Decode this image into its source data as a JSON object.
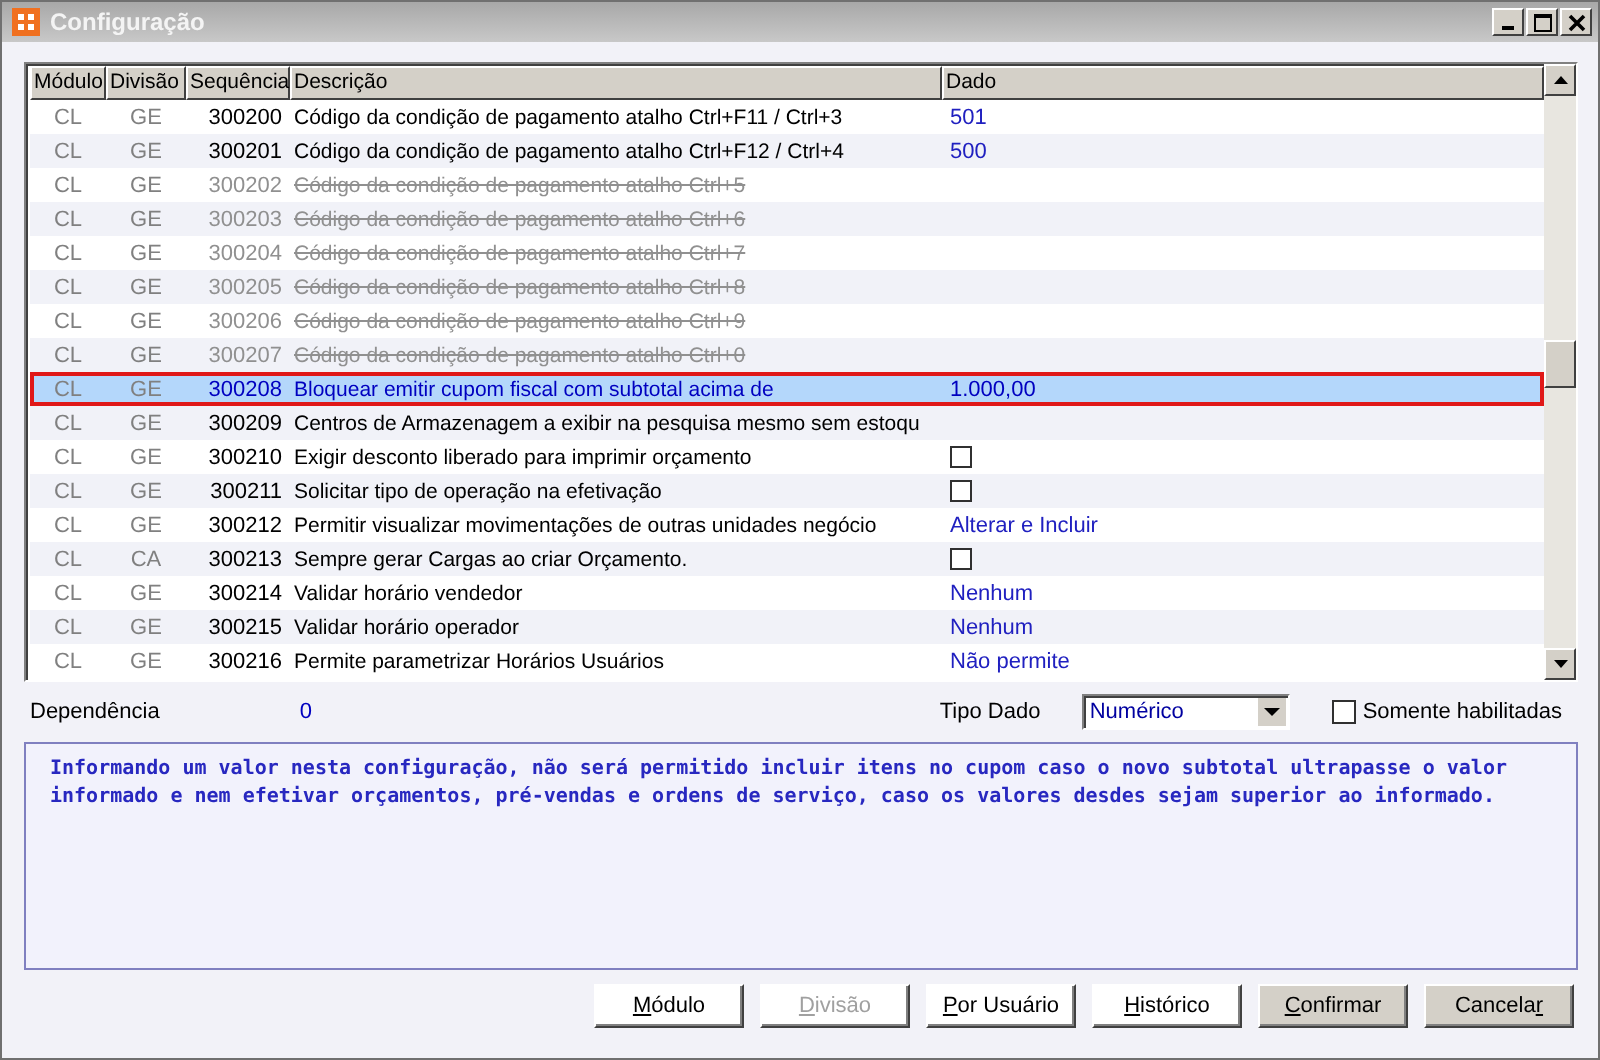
{
  "window": {
    "title": "Configuração"
  },
  "table": {
    "columns": [
      "Módulo",
      "Divisão",
      "Sequência",
      "Descrição",
      "Dado"
    ],
    "rows": [
      {
        "modulo": "CL",
        "divisao": "GE",
        "sequencia": "300200",
        "descricao": "Código da condição de pagamento atalho Ctrl+F11 / Ctrl+3",
        "dado": {
          "kind": "text",
          "text": "501"
        },
        "disabled": false,
        "selected": false
      },
      {
        "modulo": "CL",
        "divisao": "GE",
        "sequencia": "300201",
        "descricao": "Código da condição de pagamento atalho Ctrl+F12 / Ctrl+4",
        "dado": {
          "kind": "text",
          "text": "500"
        },
        "disabled": false,
        "selected": false
      },
      {
        "modulo": "CL",
        "divisao": "GE",
        "sequencia": "300202",
        "descricao": "Código da condição de pagamento atalho Ctrl+5",
        "dado": {
          "kind": "none"
        },
        "disabled": true,
        "selected": false
      },
      {
        "modulo": "CL",
        "divisao": "GE",
        "sequencia": "300203",
        "descricao": "Código da condição de pagamento atalho Ctrl+6",
        "dado": {
          "kind": "none"
        },
        "disabled": true,
        "selected": false
      },
      {
        "modulo": "CL",
        "divisao": "GE",
        "sequencia": "300204",
        "descricao": "Código da condição de pagamento atalho Ctrl+7",
        "dado": {
          "kind": "none"
        },
        "disabled": true,
        "selected": false
      },
      {
        "modulo": "CL",
        "divisao": "GE",
        "sequencia": "300205",
        "descricao": "Código da condição de pagamento atalho Ctrl+8",
        "dado": {
          "kind": "none"
        },
        "disabled": true,
        "selected": false
      },
      {
        "modulo": "CL",
        "divisao": "GE",
        "sequencia": "300206",
        "descricao": "Código da condição de pagamento atalho Ctrl+9",
        "dado": {
          "kind": "none"
        },
        "disabled": true,
        "selected": false
      },
      {
        "modulo": "CL",
        "divisao": "GE",
        "sequencia": "300207",
        "descricao": "Código da condição de pagamento atalho Ctrl+0",
        "dado": {
          "kind": "none"
        },
        "disabled": true,
        "selected": false
      },
      {
        "modulo": "CL",
        "divisao": "GE",
        "sequencia": "300208",
        "descricao": "Bloquear emitir cupom fiscal com subtotal acima de",
        "dado": {
          "kind": "text",
          "text": "1.000,00"
        },
        "disabled": false,
        "selected": true
      },
      {
        "modulo": "CL",
        "divisao": "GE",
        "sequencia": "300209",
        "descricao": "Centros de Armazenagem a exibir na pesquisa mesmo sem estoqu",
        "dado": {
          "kind": "none"
        },
        "disabled": false,
        "selected": false
      },
      {
        "modulo": "CL",
        "divisao": "GE",
        "sequencia": "300210",
        "descricao": "Exigir desconto liberado para imprimir orçamento",
        "dado": {
          "kind": "checkbox",
          "checked": false
        },
        "disabled": false,
        "selected": false
      },
      {
        "modulo": "CL",
        "divisao": "GE",
        "sequencia": "300211",
        "descricao": "Solicitar tipo de operação na efetivação",
        "dado": {
          "kind": "checkbox",
          "checked": false
        },
        "disabled": false,
        "selected": false
      },
      {
        "modulo": "CL",
        "divisao": "GE",
        "sequencia": "300212",
        "descricao": "Permitir visualizar movimentações de outras unidades negócio",
        "dado": {
          "kind": "text",
          "text": "Alterar e Incluir"
        },
        "disabled": false,
        "selected": false
      },
      {
        "modulo": "CL",
        "divisao": "CA",
        "sequencia": "300213",
        "descricao": "Sempre gerar Cargas ao criar Orçamento.",
        "dado": {
          "kind": "checkbox",
          "checked": false
        },
        "disabled": false,
        "selected": false
      },
      {
        "modulo": "CL",
        "divisao": "GE",
        "sequencia": "300214",
        "descricao": "Validar horário vendedor",
        "dado": {
          "kind": "text",
          "text": "Nenhum"
        },
        "disabled": false,
        "selected": false
      },
      {
        "modulo": "CL",
        "divisao": "GE",
        "sequencia": "300215",
        "descricao": "Validar horário operador",
        "dado": {
          "kind": "text",
          "text": "Nenhum"
        },
        "disabled": false,
        "selected": false
      },
      {
        "modulo": "CL",
        "divisao": "GE",
        "sequencia": "300216",
        "descricao": "Permite parametrizar Horários Usuários",
        "dado": {
          "kind": "text",
          "text": "Não permite"
        },
        "disabled": false,
        "selected": false
      }
    ]
  },
  "dependencia": {
    "label": "Dependência",
    "value": "0"
  },
  "tipo_dado": {
    "label": "Tipo Dado",
    "value": "Numérico"
  },
  "somente_habilitadas": {
    "label": "Somente habilitadas",
    "checked": false
  },
  "description": "Informando um valor nesta configuração, não será permitido incluir itens no cupom caso o novo subtotal ultrapasse o valor informado e nem efetivar orçamentos, pré-vendas e ordens de serviço, caso os valores desdes sejam superior ao informado.",
  "buttons": [
    {
      "key": "M",
      "after": "ódulo",
      "disabled": false
    },
    {
      "key": "D",
      "after": "ivisão",
      "disabled": true
    },
    {
      "key": "P",
      "after": "or Usuário",
      "disabled": false
    },
    {
      "key": "H",
      "after": "istórico",
      "disabled": false
    },
    {
      "key": "C",
      "after": "onfirmar",
      "disabled": false
    },
    {
      "before": "Cancela",
      "key": "r",
      "disabled": false
    }
  ]
}
